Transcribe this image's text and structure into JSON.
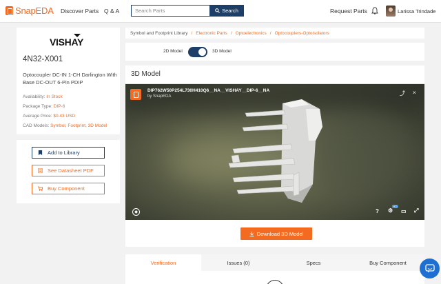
{
  "brand": {
    "name": "SnapEDA",
    "accent": "#f26b21",
    "navy": "#1d3e66"
  },
  "nav": {
    "discover": "Discover Parts",
    "qa": "Q & A",
    "request": "Request Parts",
    "user": "Larissa Trindade"
  },
  "search": {
    "placeholder": "Search Parts",
    "button": "Search"
  },
  "part": {
    "manufacturer": "VISHAY",
    "number": "4N32-X001",
    "description": "Optocoupler DC-IN 1-CH Darlington With Base DC-OUT 6-Pin PDIP",
    "specs": [
      {
        "label": "Availability:",
        "value": "In Stock"
      },
      {
        "label": "Package Type:",
        "value": "DIP-6"
      },
      {
        "label": "Average Price:",
        "value": "$0.43 USD"
      },
      {
        "label": "CAD Models:",
        "value": "Symbol, Footprint, 3D Model"
      }
    ]
  },
  "actions": {
    "add_library": "Add to Library",
    "datasheet": "See Datasheet PDF",
    "buy": "Buy Component"
  },
  "breadcrumb": [
    "Symbol and Footprint Library",
    "Electronic Parts",
    "Optoelectronics",
    "Optocouplers-Optoisolators"
  ],
  "toggle": {
    "left": "2D Model",
    "right": "3D Model",
    "state": "3D"
  },
  "model": {
    "title": "3D Model",
    "name": "DIP762W50P254L730H410Q6__NA__VISHAY__DIP-6__NA",
    "by": "by SnapEDA",
    "download": "Download 3D Model",
    "help": "?",
    "settings_badge": "HD"
  },
  "tabs": [
    "Verification",
    "Issues (0)",
    "Specs",
    "Buy Component"
  ],
  "active_tab": "Verification"
}
